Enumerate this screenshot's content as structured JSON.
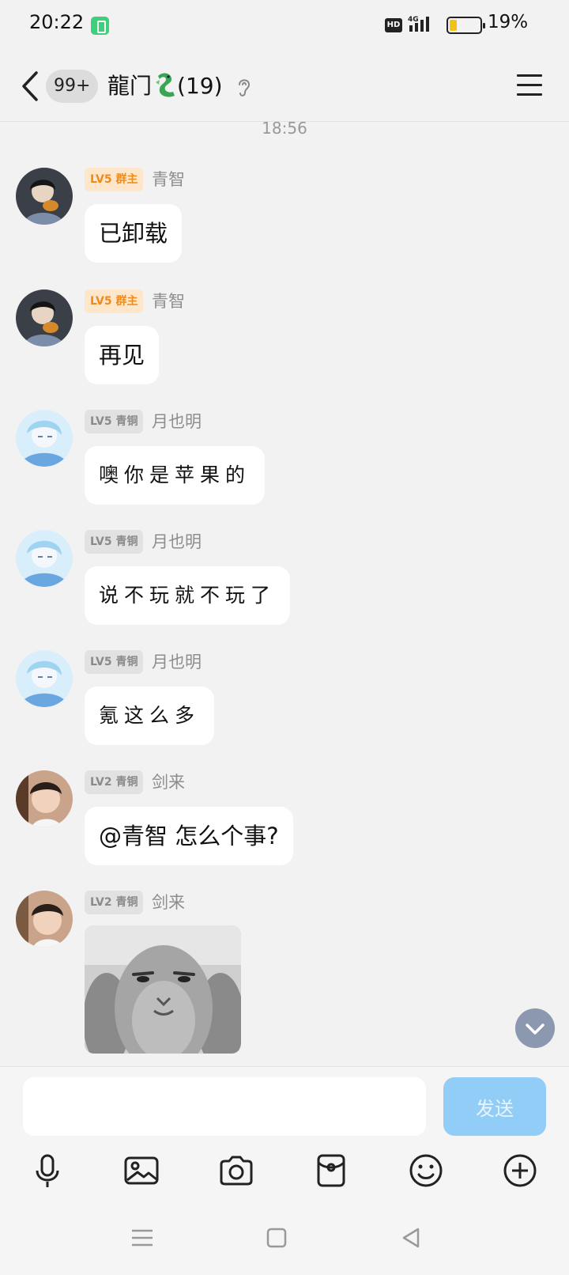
{
  "status": {
    "time": "20:22",
    "network": "4G",
    "hd_label": "HD",
    "battery_percent": "19%"
  },
  "header": {
    "unread_count": "99+",
    "title": "龍门",
    "member_count": "(19)"
  },
  "chat": {
    "time_divider": "18:56",
    "messages": [
      {
        "tag": "LV5 群主",
        "nickname": "青智",
        "text": "已卸载"
      },
      {
        "tag": "LV5 群主",
        "nickname": "青智",
        "text": "再见"
      },
      {
        "tag": "LV5 青铜",
        "nickname": "月也明",
        "text": "噢你是苹果的"
      },
      {
        "tag": "LV5 青铜",
        "nickname": "月也明",
        "text": "说不玩就不玩了"
      },
      {
        "tag": "LV5 青铜",
        "nickname": "月也明",
        "text": "氪这么多"
      },
      {
        "tag": "LV2 青铜",
        "nickname": "剑来",
        "text": "@青智 怎么个事?"
      },
      {
        "tag": "LV2 青铜",
        "nickname": "剑来",
        "text": ""
      }
    ]
  },
  "input": {
    "value": "",
    "placeholder": "",
    "send_label": "发送"
  },
  "toolbar": {
    "icons": [
      "microphone-icon",
      "image-icon",
      "camera-icon",
      "red-packet-icon",
      "emoji-icon",
      "plus-icon"
    ]
  },
  "colors": {
    "owner_tag_bg": "#fde6c9",
    "owner_tag_text": "#f08a1a",
    "member_tag_bg": "#e2e2e2",
    "send_button": "#92cdf8",
    "background": "#f2f2f2"
  }
}
